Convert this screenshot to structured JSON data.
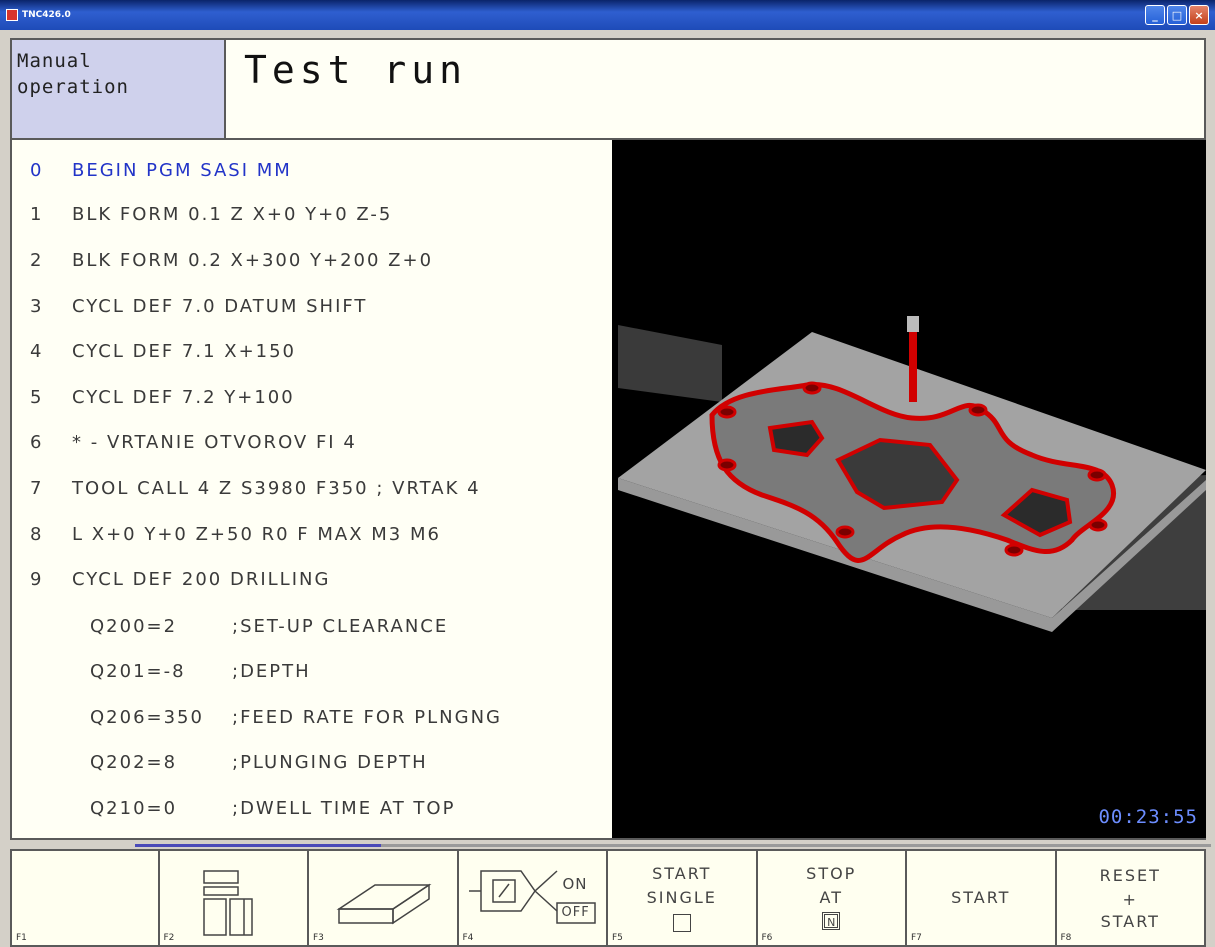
{
  "window": {
    "title": "TNC426.0"
  },
  "header": {
    "mode_line1": "Manual",
    "mode_line2": "operation",
    "subtitle": "Test run"
  },
  "program": {
    "lines": [
      {
        "n": "0",
        "text": "BEGIN PGM SASI MM"
      },
      {
        "n": "1",
        "text": "BLK FORM 0.1 Z X+0 Y+0 Z-5"
      },
      {
        "n": "2",
        "text": "BLK FORM 0.2 X+300 Y+200 Z+0"
      },
      {
        "n": "3",
        "text": "CYCL DEF 7.0 DATUM SHIFT"
      },
      {
        "n": "4",
        "text": "CYCL DEF 7.1 X+150"
      },
      {
        "n": "5",
        "text": "CYCL DEF 7.2 Y+100"
      },
      {
        "n": "6",
        "text": "* - VRTANIE OTVOROV FI 4"
      },
      {
        "n": "7",
        "text": "TOOL CALL 4 Z S3980 F350 ; VRTAK 4"
      },
      {
        "n": "8",
        "text": "L X+0 Y+0 Z+50 R0 F MAX M3 M6"
      },
      {
        "n": "9",
        "text": "CYCL DEF 200 DRILLING"
      }
    ],
    "params": [
      {
        "q": "Q200=2",
        "comment": ";SET-UP CLEARANCE"
      },
      {
        "q": "Q201=-8",
        "comment": ";DEPTH"
      },
      {
        "q": "Q206=350",
        "comment": ";FEED RATE FOR PLNGNG"
      },
      {
        "q": "Q202=8",
        "comment": ";PLUNGING DEPTH"
      },
      {
        "q": "Q210=0",
        "comment": ";DWELL TIME AT TOP"
      }
    ]
  },
  "graphics": {
    "clock": "00:23:55"
  },
  "softkeys": [
    {
      "fkey": "F1",
      "lines": []
    },
    {
      "fkey": "F2",
      "icon": "view-layout-icon"
    },
    {
      "fkey": "F3",
      "icon": "blank-form-icon"
    },
    {
      "fkey": "F4",
      "icon": "block-skip-toggle-icon",
      "on": "ON",
      "off": "OFF"
    },
    {
      "fkey": "F5",
      "line1": "START",
      "line2": "SINGLE"
    },
    {
      "fkey": "F6",
      "line1": "STOP",
      "line2": "AT",
      "indicator": "N"
    },
    {
      "fkey": "F7",
      "line1": "START"
    },
    {
      "fkey": "F8",
      "line1": "RESET",
      "line2": "+",
      "line3": "START"
    }
  ]
}
